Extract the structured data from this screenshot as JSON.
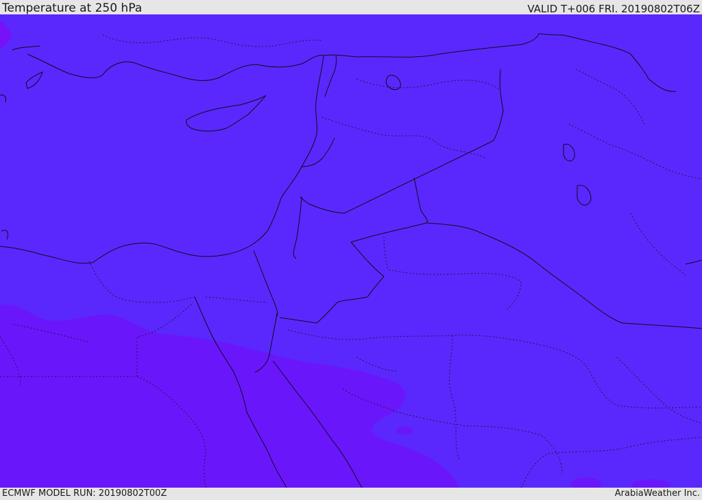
{
  "header": {
    "title": "Temperature at 250 hPa",
    "valid": "VALID T+006 FRI. 20190802T06Z"
  },
  "footer": {
    "model_run": "ECMWF MODEL RUN: 20190802T00Z",
    "credit": "ArabiaWeather Inc."
  },
  "map": {
    "colors": {
      "field_main": "#5a28fc",
      "field_warm": "#6a16fb",
      "field_hot": "#7612f5",
      "border": "#0c0c20",
      "coast": "#0b0b1e"
    }
  }
}
